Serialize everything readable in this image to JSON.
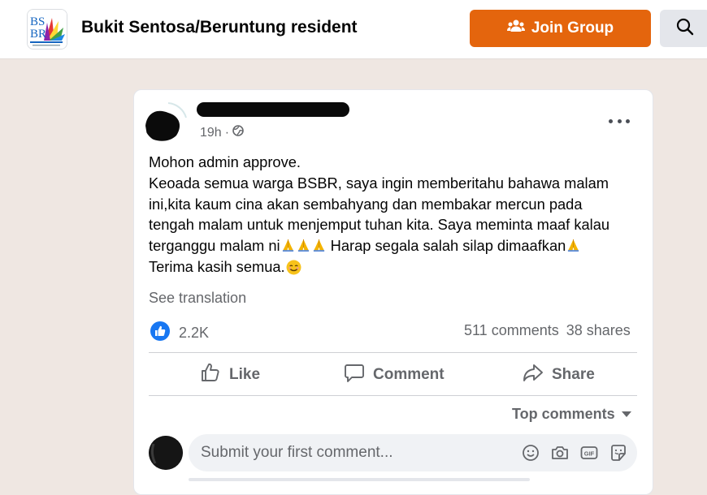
{
  "header": {
    "group_name": "Bukit Sentosa/Beruntung resident",
    "logo_text": "BSBR",
    "join_label": "Join Group"
  },
  "post": {
    "time": "19h",
    "lines": [
      "Mohon admin approve.",
      "Keoada semua warga BSBR, saya ingin memberitahu bahawa malam",
      "ini,kita kaum cina akan sembahyang dan membakar mercun pada",
      "tengah malam untuk menjemput tuhan kita. Saya meminta maaf kalau"
    ],
    "line5_a": "terganggu malam ni",
    "line5_b": " Harap segala salah silap dimaafkan",
    "line6": "Terima kasih semua.",
    "see_translation": "See translation",
    "likes": "2.2K",
    "comments": "511 comments",
    "shares": "38 shares"
  },
  "actions": {
    "like": "Like",
    "comment": "Comment",
    "share": "Share"
  },
  "comments": {
    "sort_label": "Top comments",
    "placeholder": "Submit your first comment..."
  },
  "colors": {
    "join_button": "#e4650d",
    "like_blue": "#1877f2",
    "background": "#efe7e2"
  }
}
